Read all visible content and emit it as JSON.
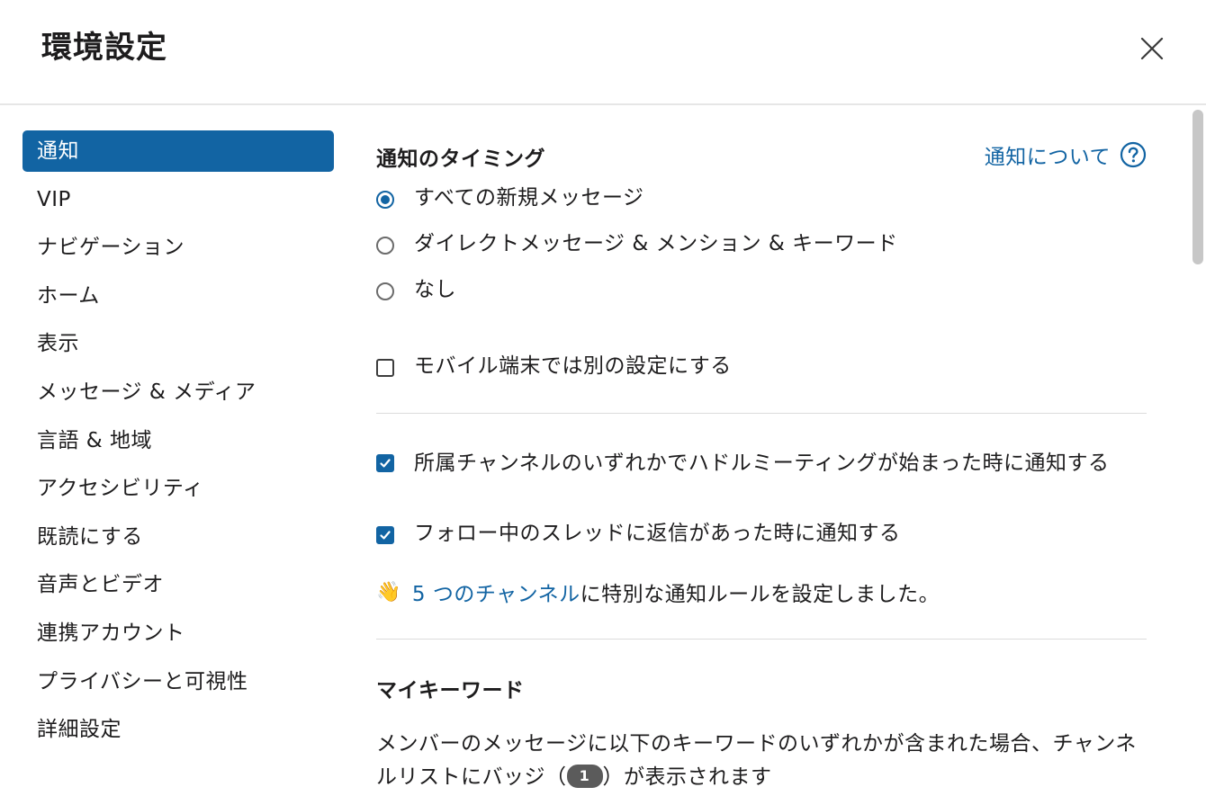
{
  "header": {
    "title": "環境設定",
    "close_icon": "close-icon"
  },
  "sidebar": {
    "items": [
      {
        "label": "通知",
        "active": true
      },
      {
        "label": "VIP",
        "active": false
      },
      {
        "label": "ナビゲーション",
        "active": false
      },
      {
        "label": "ホーム",
        "active": false
      },
      {
        "label": "表示",
        "active": false
      },
      {
        "label": "メッセージ & メディア",
        "active": false
      },
      {
        "label": "言語 & 地域",
        "active": false
      },
      {
        "label": "アクセシビリティ",
        "active": false
      },
      {
        "label": "既読にする",
        "active": false
      },
      {
        "label": "音声とビデオ",
        "active": false
      },
      {
        "label": "連携アカウント",
        "active": false
      },
      {
        "label": "プライバシーと可視性",
        "active": false
      },
      {
        "label": "詳細設定",
        "active": false
      }
    ]
  },
  "main": {
    "timing": {
      "title": "通知のタイミング",
      "help_link": "通知について",
      "options": [
        {
          "label": "すべての新規メッセージ",
          "selected": true
        },
        {
          "label": "ダイレクトメッセージ & メンション & キーワード",
          "selected": false
        },
        {
          "label": "なし",
          "selected": false
        }
      ],
      "mobile_checkbox": {
        "label": "モバイル端末では別の設定にする",
        "checked": false
      }
    },
    "checks": [
      {
        "label": "所属チャンネルのいずれかでハドルミーティングが始まった時に通知する",
        "checked": true
      },
      {
        "label": "フォロー中のスレッドに返信があった時に通知する",
        "checked": true
      }
    ],
    "rules_note": {
      "emoji": "👋",
      "link": "5 つのチャンネル",
      "text": "に特別な通知ルールを設定しました。"
    },
    "keywords": {
      "title": "マイキーワード",
      "desc_before": "メンバーのメッセージに以下のキーワードのいずれかが含まれた場合、チャンネルリストにバッジ（",
      "badge": "1",
      "desc_after": "）が表示されます"
    }
  },
  "colors": {
    "accent": "#1264a3",
    "text": "#1d1c1d",
    "divider": "#dcdcdc"
  }
}
